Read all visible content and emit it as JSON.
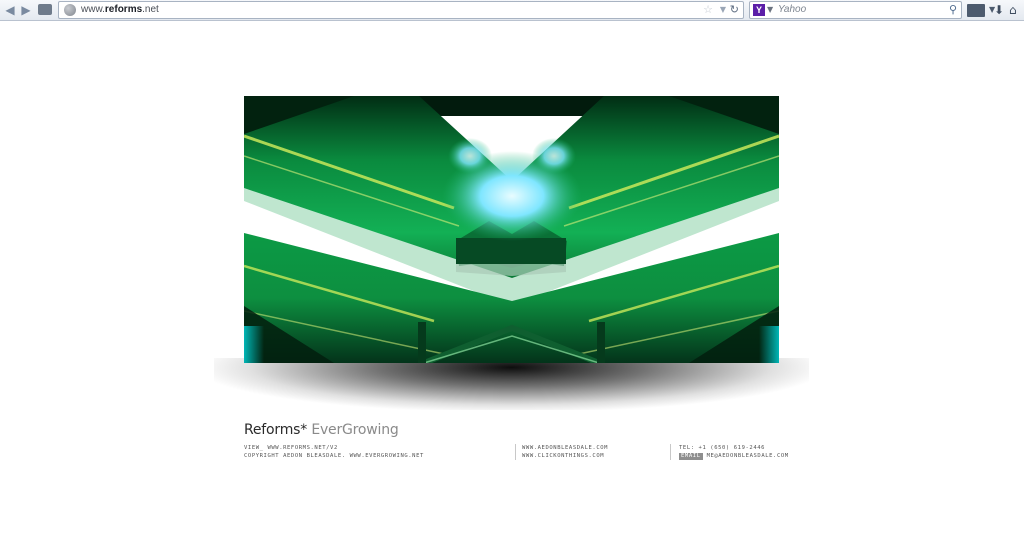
{
  "browser": {
    "url_prefix": "www.",
    "url_domain": "reforms",
    "url_suffix": ".net",
    "search_placeholder": "Yahoo",
    "search_engine_letter": "Y",
    "icons": [
      "back-icon",
      "forward-icon",
      "tab-groups-icon",
      "globe-icon",
      "bookmark-star-icon",
      "dropdown-icon",
      "reload-icon",
      "yahoo-logo",
      "search-icon",
      "bookmarks-menu-icon",
      "downloads-icon",
      "home-icon"
    ]
  },
  "page": {
    "brand": "Reforms*",
    "tagline": "EverGrowing",
    "footer": {
      "col_a": [
        "View_ www.reforms.net/v2",
        "Copyright Aedon Bleasdale. www.evergrowing.net"
      ],
      "col_b": [
        "www.aedonbleasdale.com",
        "www.clickonthings.com"
      ],
      "tel": "Tel: +1 (650) 619-2446",
      "email_label": "Email",
      "email": "me@aedonbleasdale.com"
    }
  },
  "colors": {
    "accent_green": "#0fa04c",
    "dark_green": "#04301a",
    "highlight_yellow": "#c8e85a",
    "cyan_glow": "#b8f2ff"
  }
}
